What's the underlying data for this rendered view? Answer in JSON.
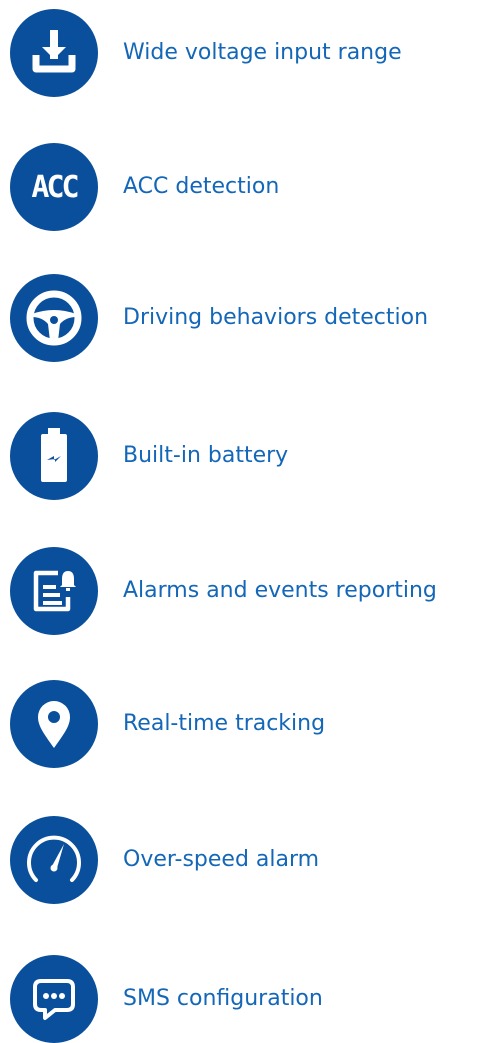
{
  "colors": {
    "accent": "#0a4f9c",
    "label": "#1467b8",
    "icon_fg": "#ffffff"
  },
  "features": [
    {
      "icon": "download-tray-icon",
      "label": "Wide voltage input range"
    },
    {
      "icon": "acc-icon",
      "icon_text": "ACC",
      "label": "ACC detection"
    },
    {
      "icon": "steering-wheel-icon",
      "label": "Driving behaviors detection"
    },
    {
      "icon": "battery-charging-icon",
      "label": "Built-in battery"
    },
    {
      "icon": "report-bell-icon",
      "label": "Alarms and events reporting"
    },
    {
      "icon": "map-pin-icon",
      "label": "Real-time tracking"
    },
    {
      "icon": "speedometer-icon",
      "label": "Over-speed alarm"
    },
    {
      "icon": "chat-bubble-icon",
      "label": "SMS configuration"
    }
  ]
}
